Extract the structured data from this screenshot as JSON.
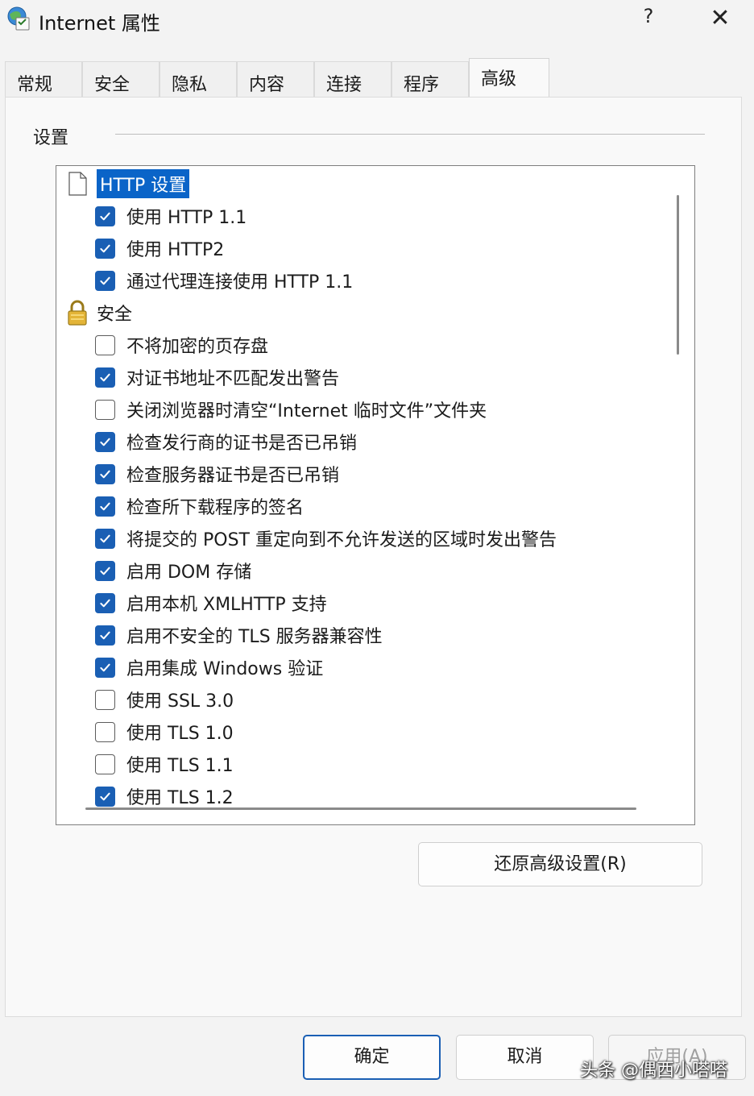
{
  "window": {
    "title": "Internet 属性",
    "help": "?",
    "close": "✕",
    "icon": "internet-globe-icon"
  },
  "tabs": [
    {
      "label": "常规",
      "active": false
    },
    {
      "label": "安全",
      "active": false
    },
    {
      "label": "隐私",
      "active": false
    },
    {
      "label": "内容",
      "active": false
    },
    {
      "label": "连接",
      "active": false
    },
    {
      "label": "程序",
      "active": false
    },
    {
      "label": "高级",
      "active": true
    }
  ],
  "settings": {
    "group_label": "设置",
    "items": [
      {
        "type": "category",
        "icon": "page-icon",
        "label": "HTTP 设置",
        "selected": true
      },
      {
        "type": "checkbox",
        "label": "使用 HTTP 1.1",
        "checked": true
      },
      {
        "type": "checkbox",
        "label": "使用 HTTP2",
        "checked": true
      },
      {
        "type": "checkbox",
        "label": "通过代理连接使用 HTTP 1.1",
        "checked": true
      },
      {
        "type": "category",
        "icon": "lock-icon",
        "label": "安全",
        "selected": false
      },
      {
        "type": "checkbox",
        "label": "不将加密的页存盘",
        "checked": false
      },
      {
        "type": "checkbox",
        "label": "对证书地址不匹配发出警告",
        "checked": true
      },
      {
        "type": "checkbox",
        "label": "关闭浏览器时清空“Internet 临时文件”文件夹",
        "checked": false
      },
      {
        "type": "checkbox",
        "label": "检查发行商的证书是否已吊销",
        "checked": true
      },
      {
        "type": "checkbox",
        "label": "检查服务器证书是否已吊销",
        "checked": true
      },
      {
        "type": "checkbox",
        "label": "检查所下载程序的签名",
        "checked": true
      },
      {
        "type": "checkbox",
        "label": "将提交的 POST 重定向到不允许发送的区域时发出警告",
        "checked": true
      },
      {
        "type": "checkbox",
        "label": "启用 DOM 存储",
        "checked": true
      },
      {
        "type": "checkbox",
        "label": "启用本机 XMLHTTP 支持",
        "checked": true
      },
      {
        "type": "checkbox",
        "label": "启用不安全的 TLS 服务器兼容性",
        "checked": true
      },
      {
        "type": "checkbox",
        "label": "启用集成 Windows 验证",
        "checked": true
      },
      {
        "type": "checkbox",
        "label": "使用 SSL 3.0",
        "checked": false
      },
      {
        "type": "checkbox",
        "label": "使用 TLS 1.0",
        "checked": false
      },
      {
        "type": "checkbox",
        "label": "使用 TLS 1.1",
        "checked": false
      },
      {
        "type": "checkbox",
        "label": "使用 TLS 1.2",
        "checked": true
      }
    ]
  },
  "restore_button": "还原高级设置(R)",
  "footer": {
    "ok": "确定",
    "cancel": "取消",
    "apply": "应用(A)"
  },
  "watermark": "头条 @偶西小嗒嗒",
  "colors": {
    "accent": "#1a5fb4",
    "selection": "#0a64c8",
    "background": "#f3f3f3"
  }
}
